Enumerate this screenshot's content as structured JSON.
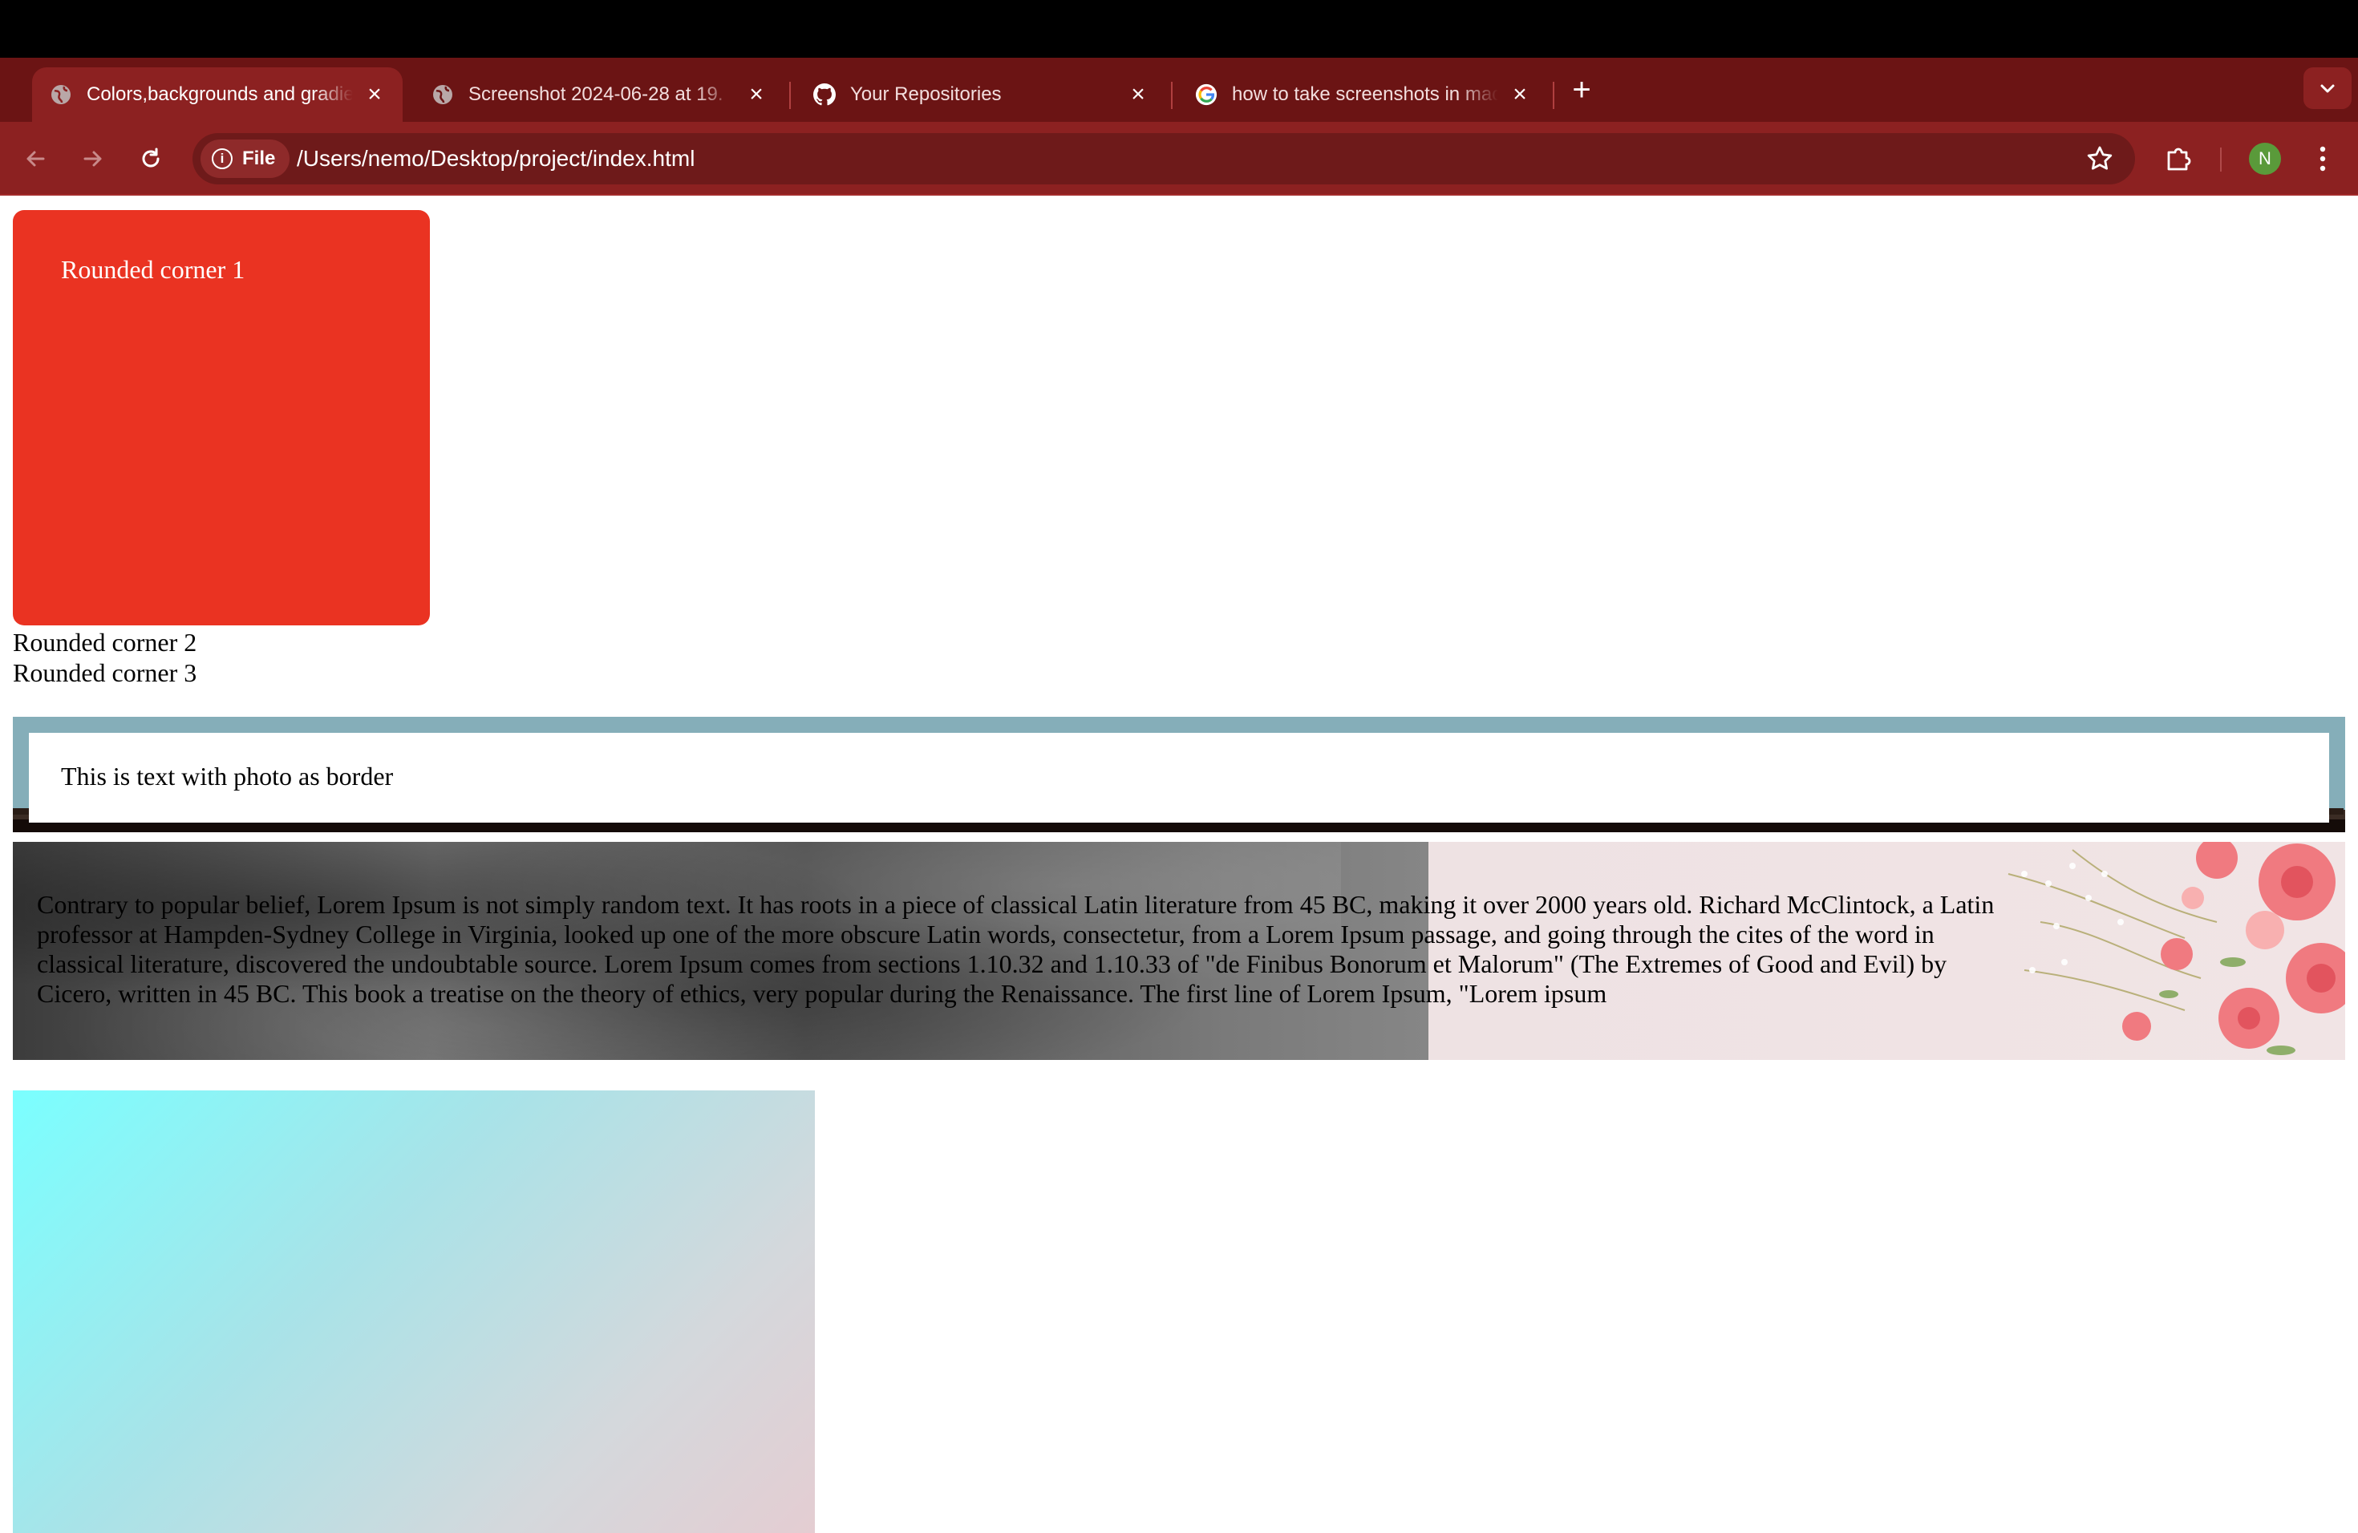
{
  "browser": {
    "tabs": [
      {
        "title": "Colors,backgrounds and gradients",
        "favicon": "globe-icon",
        "active": true
      },
      {
        "title": "Screenshot 2024-06-28 at 19.",
        "favicon": "globe-icon",
        "active": false
      },
      {
        "title": "Your Repositories",
        "favicon": "github-icon",
        "active": false
      },
      {
        "title": "how to take screenshots in mac",
        "favicon": "google-icon",
        "active": false
      }
    ],
    "new_tab": "+",
    "close_glyph": "×",
    "security_chip": "File",
    "url": "/Users/nemo/Desktop/project/index.html",
    "profile_initial": "N",
    "colors": {
      "tabstrip": "#6b1414",
      "toolbar": "#8c2121",
      "omnibox": "#6e1a1a"
    }
  },
  "page": {
    "rounded_corner_1": "Rounded corner 1",
    "rounded_corner_2": "Rounded corner 2",
    "rounded_corner_3": "Rounded corner 3",
    "photo_border_text": "This is text with photo as border",
    "lorem_text": "Contrary to popular belief, Lorem Ipsum is not simply random text. It has roots in a piece of classical Latin literature from 45 BC, making it over 2000 years old. Richard McClintock, a Latin professor at Hampden-Sydney College in Virginia, looked up one of the more obscure Latin words, consectetur, from a Lorem Ipsum passage, and going through the cites of the word in classical literature, discovered the undoubtable source. Lorem Ipsum comes from sections 1.10.32 and 1.10.33 of \"de Finibus Bonorum et Malorum\" (The Extremes of Good and Evil) by Cicero, written in 45 BC. This book a treatise on the theory of ethics, very popular during the Renaissance. The first line of Lorem Ipsum, \"Lorem ipsum",
    "colors": {
      "rounded_box": "#ea3322",
      "photo_border": "#85aeb9",
      "gradient_start": "#7affff",
      "gradient_end": "#e4cdd2"
    }
  }
}
